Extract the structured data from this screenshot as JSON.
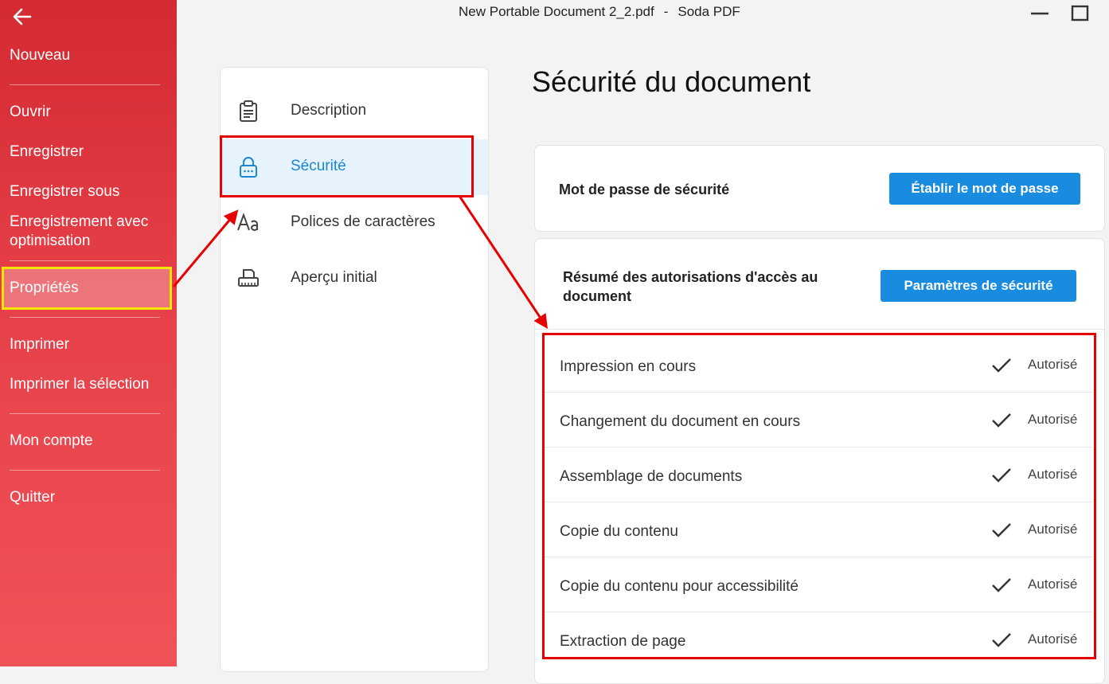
{
  "window": {
    "document_name": "New Portable Document 2_2.pdf",
    "separator": "-",
    "app_name": "Soda PDF"
  },
  "sidebar": {
    "items": [
      {
        "label": "Nouveau"
      },
      {
        "label": "Ouvrir"
      },
      {
        "label": "Enregistrer"
      },
      {
        "label": "Enregistrer sous"
      },
      {
        "label": "Enregistrement avec optimisation"
      },
      {
        "label": "Propriétés"
      },
      {
        "label": "Imprimer"
      },
      {
        "label": "Imprimer la sélection"
      },
      {
        "label": "Mon compte"
      },
      {
        "label": "Quitter"
      }
    ]
  },
  "properties_nav": {
    "items": [
      {
        "label": "Description",
        "icon": "clipboard-icon"
      },
      {
        "label": "Sécurité",
        "icon": "lock-icon"
      },
      {
        "label": "Polices de caractères",
        "icon": "font-icon"
      },
      {
        "label": "Aperçu initial",
        "icon": "printer-icon"
      }
    ]
  },
  "main": {
    "title": "Sécurité du document",
    "password_card": {
      "title": "Mot de passe de sécurité",
      "button": "Établir le mot de passe"
    },
    "permissions_card": {
      "title": "Résumé des autorisations d'accès au document",
      "button": "Paramètres de sécurité"
    },
    "permissions": [
      {
        "label": "Impression en cours",
        "status": "Autorisé"
      },
      {
        "label": "Changement du document en cours",
        "status": "Autorisé"
      },
      {
        "label": "Assemblage de documents",
        "status": "Autorisé"
      },
      {
        "label": "Copie du contenu",
        "status": "Autorisé"
      },
      {
        "label": "Copie du contenu pour accessibilité",
        "status": "Autorisé"
      },
      {
        "label": "Extraction de page",
        "status": "Autorisé"
      }
    ]
  },
  "colors": {
    "sidebar": "#e03a42",
    "accent": "#1a8ce0",
    "annotation_red": "#e60000",
    "annotation_yellow": "#f5e800"
  }
}
